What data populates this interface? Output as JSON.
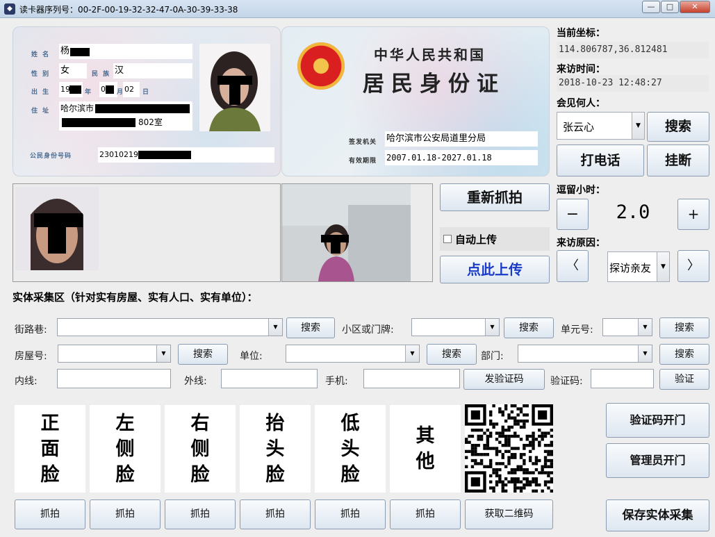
{
  "window": {
    "title": "读卡器序列号：00-2F-00-19-32-32-47-0A-30-39-33-38",
    "minimize": "—",
    "maximize": "□",
    "close": "✕"
  },
  "id_front": {
    "name_label": "姓  名",
    "name_value": "杨",
    "gender_label": "性  别",
    "gender_value": "女",
    "ethnicity_label": "民  族",
    "ethnicity_value": "汉",
    "birth_label": "出  生",
    "birth_year": "19",
    "birth_month": "0",
    "birth_day": "02",
    "birth_year_unit": "年",
    "birth_month_unit": "月",
    "birth_day_unit": "日",
    "address_label": "住  址",
    "address_line1": "哈尔滨市",
    "address_line2": "802室",
    "id_label": "公民身份号码",
    "id_value": "23010219"
  },
  "id_back": {
    "country": "中华人民共和国",
    "doc_title": "居民身份证",
    "authority_label": "签发机关",
    "authority_value": "哈尔滨市公安局道里分局",
    "validity_label": "有效期限",
    "validity_value": "2007.01.18-2027.01.18"
  },
  "right_panel": {
    "coords_label": "当前坐标：",
    "coords_value": "114.806787,36.812481",
    "visit_time_label": "来访时间：",
    "visit_time_value": "2018-10-23 12:48:27",
    "meet_label": "会见何人：",
    "meet_value": "张云心",
    "search_btn": "搜索",
    "call_btn": "打电话",
    "hangup_btn": "挂断",
    "stay_label": "逗留小时：",
    "stay_minus": "−",
    "stay_value": "2.0",
    "stay_plus": "+",
    "reason_label": "来访原因：",
    "reason_prev": "〈",
    "reason_value": "探访亲友",
    "reason_next": "〉"
  },
  "capture": {
    "recapture_btn": "重新抓拍",
    "auto_upload_label": "自动上传",
    "upload_btn": "点此上传",
    "auto_upload_checked": false
  },
  "entity": {
    "section_title": "实体采集区（针对实有房屋、实有人口、实有单位）：",
    "street_label": "街路巷:",
    "community_label": "小区或门牌:",
    "unit_no_label": "单元号:",
    "room_label": "房屋号:",
    "org_label": "单位:",
    "dept_label": "部门:",
    "inner_line_label": "内线:",
    "outer_line_label": "外线:",
    "mobile_label": "手机:",
    "send_code_btn": "发验证码",
    "code_label": "验证码:",
    "verify_btn": "验证",
    "search_btn": "搜索"
  },
  "faces": {
    "tiles": [
      "正面脸",
      "左侧脸",
      "右侧脸",
      "抬头脸",
      "低头脸",
      "其他"
    ],
    "capture_btn": "抓拍",
    "get_qr_btn": "获取二维码"
  },
  "actions": {
    "code_open_btn": "验证码开门",
    "admin_open_btn": "管理员开门",
    "save_btn": "保存实体采集"
  }
}
